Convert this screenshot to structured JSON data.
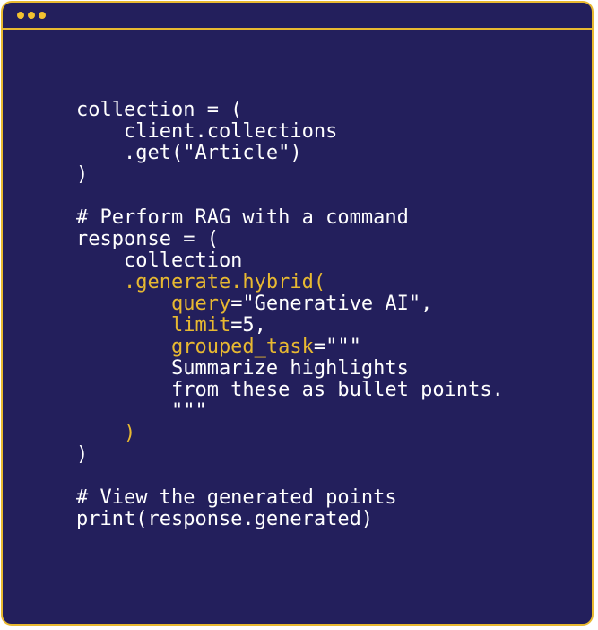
{
  "colors": {
    "background": "#231f5c",
    "border": "#e8b931",
    "text": "#ffffff",
    "highlight": "#e8b931"
  },
  "window": {
    "dots": [
      "dot",
      "dot",
      "dot"
    ]
  },
  "code": {
    "lines": [
      [
        {
          "t": "collection = (",
          "c": "w"
        }
      ],
      [
        {
          "t": "    client.collections",
          "c": "w"
        }
      ],
      [
        {
          "t": "    .get(\"Article\")",
          "c": "w"
        }
      ],
      [
        {
          "t": ")",
          "c": "w"
        }
      ],
      [],
      [
        {
          "t": "# Perform RAG with a command",
          "c": "w"
        }
      ],
      [
        {
          "t": "response = (",
          "c": "w"
        }
      ],
      [
        {
          "t": "    collection",
          "c": "w"
        }
      ],
      [
        {
          "t": "    .generate.hybrid(",
          "c": "y"
        }
      ],
      [
        {
          "t": "        query",
          "c": "y"
        },
        {
          "t": "=\"Generative AI\",",
          "c": "w"
        }
      ],
      [
        {
          "t": "        limit",
          "c": "y"
        },
        {
          "t": "=5,",
          "c": "w"
        }
      ],
      [
        {
          "t": "        grouped_task",
          "c": "y"
        },
        {
          "t": "=\"\"\"",
          "c": "w"
        }
      ],
      [
        {
          "t": "        Summarize highlights",
          "c": "w"
        }
      ],
      [
        {
          "t": "        from these as bullet points.",
          "c": "w"
        }
      ],
      [
        {
          "t": "        \"\"\"",
          "c": "w"
        }
      ],
      [
        {
          "t": "    )",
          "c": "y"
        }
      ],
      [
        {
          "t": ")",
          "c": "w"
        }
      ],
      [],
      [
        {
          "t": "# View the generated points",
          "c": "w"
        }
      ],
      [
        {
          "t": "print(response.generated)",
          "c": "w"
        }
      ]
    ]
  }
}
